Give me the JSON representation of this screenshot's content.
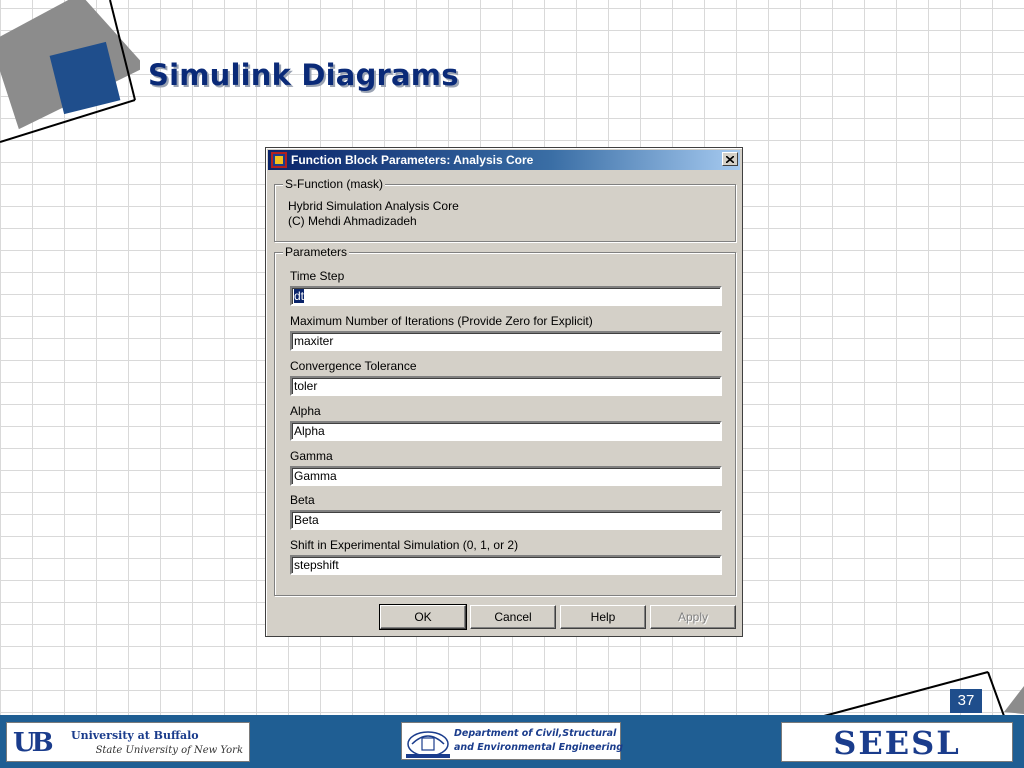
{
  "slide": {
    "title": "Simulink Diagrams",
    "page_number": "37",
    "colors": {
      "title": "#0a2a78",
      "accent_blue": "#1f4e8c",
      "deco_gray": "#8c8c8c"
    }
  },
  "dialog": {
    "title": "Function Block Parameters: Analysis Core",
    "mask_group": {
      "legend": "S-Function (mask)",
      "lines": [
        "Hybrid Simulation Analysis Core",
        "(C) Mehdi Ahmadizadeh"
      ]
    },
    "params_group": {
      "legend": "Parameters",
      "params": [
        {
          "label": "Time Step",
          "value": "dt",
          "selected": true
        },
        {
          "label": "Maximum Number of Iterations (Provide Zero for Explicit)",
          "value": "maxiter"
        },
        {
          "label": "Convergence Tolerance",
          "value": "toler"
        },
        {
          "label": "Alpha",
          "value": "Alpha"
        },
        {
          "label": "Gamma",
          "value": "Gamma"
        },
        {
          "label": "Beta",
          "value": "Beta"
        },
        {
          "label": "Shift in Experimental Simulation (0, 1, or 2)",
          "value": "stepshift"
        }
      ]
    },
    "buttons": {
      "ok": "OK",
      "cancel": "Cancel",
      "help": "Help",
      "apply": "Apply"
    }
  },
  "footer": {
    "ub": {
      "mark": "UB",
      "name": "University at Buffalo",
      "subtitle": "State University of New York"
    },
    "department": {
      "line1": "Department of Civil,Structural",
      "line2": "and Environmental Engineering"
    },
    "lab": {
      "name": "SEESL"
    }
  }
}
